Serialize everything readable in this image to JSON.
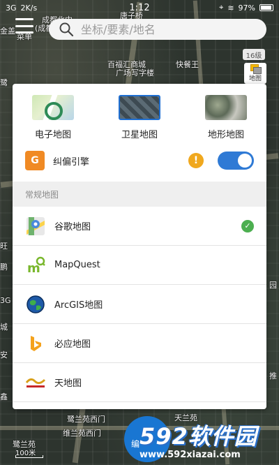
{
  "status_bar": {
    "signal": "3G",
    "speed": "2K/s",
    "time": "1:12",
    "battery": "97%"
  },
  "map_labels": [
    "成都北中",
    "(成都",
    "金盖",
    "菜单",
    "唐子桥",
    "百福汇商城",
    "广场写字楼",
    "快餐王",
    "鹭",
    "3G",
    "旺",
    "鹏",
    "城",
    "安",
    "鑫",
    "推",
    "鹭兰苑西门",
    "维兰苑西门",
    "天兰苑",
    "园",
    "鹭兰苑"
  ],
  "search": {
    "placeholder": "坐标/要素/地名"
  },
  "zoom_level": "16级",
  "layer_button": {
    "label": "地图"
  },
  "panel": {
    "map_types": [
      {
        "label": "电子地图",
        "icon": "electronic-map-thumb"
      },
      {
        "label": "卫星地图",
        "icon": "satellite-map-thumb"
      },
      {
        "label": "地形地图",
        "icon": "terrain-map-thumb"
      }
    ],
    "engine": {
      "label": "纠偏引擎",
      "icon_text": "G",
      "warning": "!",
      "enabled": true
    },
    "section_title": "常规地图",
    "providers": [
      {
        "name": "谷歌地图",
        "icon": "google-maps-icon",
        "selected": true
      },
      {
        "name": "MapQuest",
        "icon": "mapquest-icon",
        "selected": false
      },
      {
        "name": "ArcGIS地图",
        "icon": "arcgis-globe-icon",
        "selected": false
      },
      {
        "name": "必应地图",
        "icon": "bing-icon",
        "selected": false
      },
      {
        "name": "天地图",
        "icon": "tianditu-icon",
        "selected": false
      }
    ]
  },
  "edit_button": {
    "label": "编"
  },
  "scale": {
    "label": "100米"
  },
  "watermark": {
    "title": "592软件园",
    "url": "www.592xiazai.com"
  },
  "colors": {
    "accent": "#2f7ad5",
    "engine": "#f08a24",
    "warning": "#f0a81e",
    "check": "#4caf50"
  }
}
